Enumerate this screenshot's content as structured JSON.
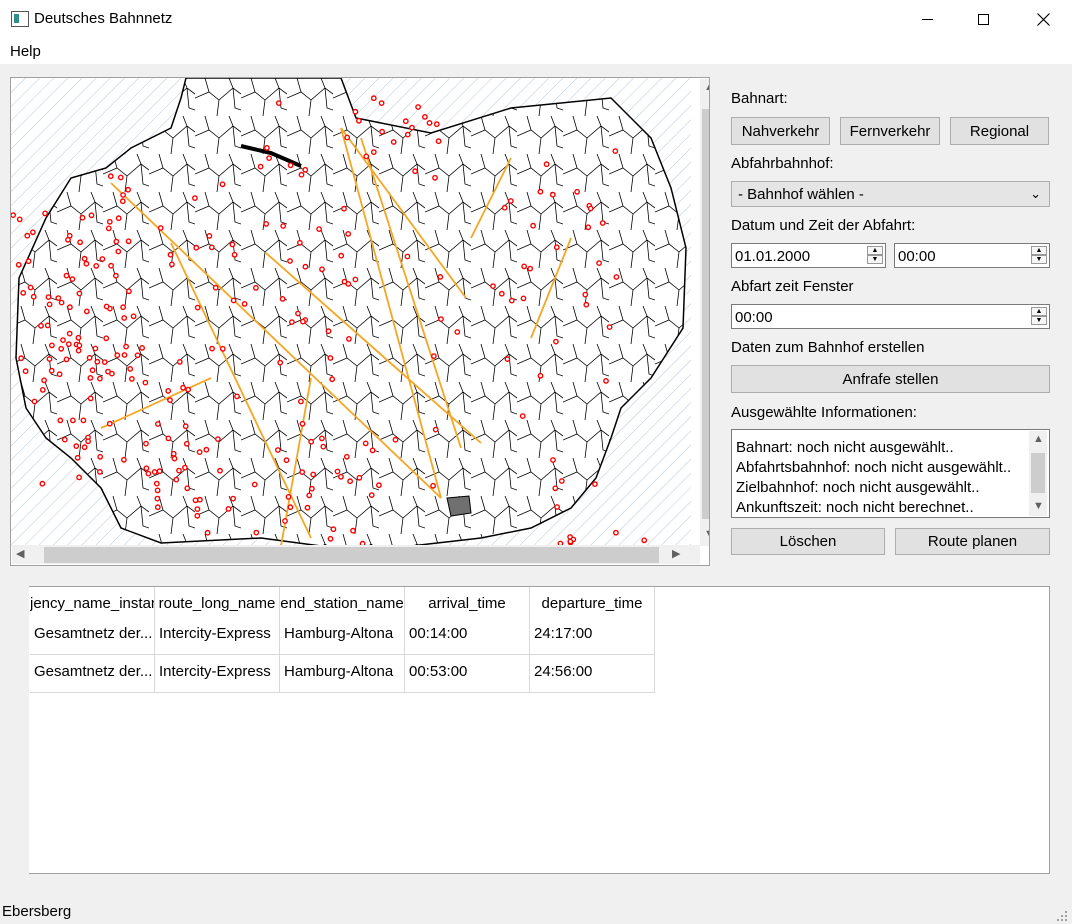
{
  "window": {
    "title": "Deutsches Bahnnetz"
  },
  "menu": {
    "help": "Help"
  },
  "panel": {
    "bahnart_label": "Bahnart:",
    "bahnart_buttons": [
      "Nahverkehr",
      "Fernverkehr",
      "Regional"
    ],
    "departure_label": "Abfahrbahnhof:",
    "departure_select": "- Bahnhof wählen -",
    "datetime_label": "Datum und Zeit der Abfahrt:",
    "date_value": "01.01.2000",
    "time_value": "00:00",
    "window_label": "Abfart zeit Fenster",
    "window_value": "00:00",
    "create_label": "Daten zum Bahnhof erstellen",
    "query_button": "Anfrafe stellen",
    "info_label": "Ausgewählte Informationen:",
    "info_lines": [
      "Bahnart: noch nicht ausgewählt..",
      "Abfahrtsbahnhof: noch nicht ausgewählt..",
      "Zielbahnhof: noch nicht ausgewählt..",
      "Ankunftszeit: noch nicht berechnet.."
    ],
    "clear_button": "Löschen",
    "route_button": "Route planen"
  },
  "table": {
    "headers": [
      "jency_name_instar",
      "route_long_name",
      "end_station_name",
      "arrival_time",
      "departure_time"
    ],
    "rows": [
      [
        "Gesamtnetz der...",
        "Intercity-Express",
        "Hamburg-Altona",
        "00:14:00",
        "24:17:00"
      ],
      [
        "Gesamtnetz der...",
        "Intercity-Express",
        "Hamburg-Altona",
        "00:53:00",
        "24:56:00"
      ]
    ]
  },
  "status": {
    "text": "Ebersberg"
  },
  "colors": {
    "station": "#ff0000",
    "route": "#f5a623",
    "border": "#000000",
    "highlight_region": "#707070"
  },
  "icons": {
    "close": "close-icon",
    "maximize": "maximize-icon",
    "minimize": "minimize-icon",
    "dropdown": "chevron-down-icon"
  }
}
